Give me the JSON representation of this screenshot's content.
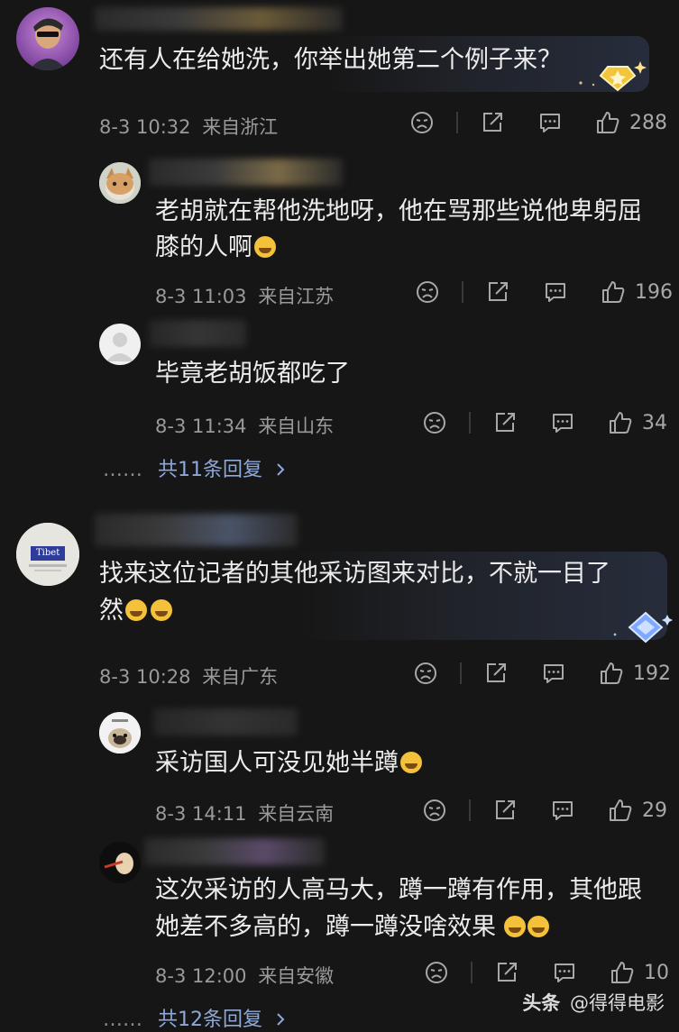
{
  "comments": [
    {
      "text": "还有人在给她洗，你举出她第二个例子来？",
      "time": "8-3 10:32",
      "location": "来自浙江",
      "likes": "288",
      "replies": [
        {
          "text_lines": [
            "老胡就在帮他洗地呀，他在骂那些说他卑躬屈",
            "膝的人啊"
          ],
          "time": "8-3 11:03",
          "location": "来自江苏",
          "likes": "196"
        },
        {
          "text_lines": [
            "毕竟老胡饭都吃了"
          ],
          "time": "8-3 11:34",
          "location": "来自山东",
          "likes": "34"
        }
      ],
      "more_dots": "……",
      "more_replies": "共11条回复",
      "avatar_text": ""
    },
    {
      "text_lines": [
        "找来这位记者的其他采访图来对比，不就一目了",
        "然"
      ],
      "time": "8-3 10:28",
      "location": "来自广东",
      "likes": "192",
      "avatar_text": "Tibet",
      "replies": [
        {
          "text_lines": [
            "采访国人可没见她半蹲"
          ],
          "time": "8-3 14:11",
          "location": "来自云南",
          "likes": "29"
        },
        {
          "text_lines": [
            "这次采访的人高马大，蹲一蹲有作用，其他跟",
            "她差不多高的，蹲一蹲没啥效果 "
          ],
          "time": "8-3 12:00",
          "location": "来自安徽",
          "likes": "10"
        }
      ],
      "more_dots": "……",
      "more_replies": "共12条回复"
    }
  ],
  "watermark": {
    "brand": "头条",
    "account": "@得得电影"
  },
  "icons": [
    "dislike-icon",
    "share-icon",
    "comment-icon",
    "like-icon",
    "chevron-right-icon",
    "badge-icon"
  ]
}
